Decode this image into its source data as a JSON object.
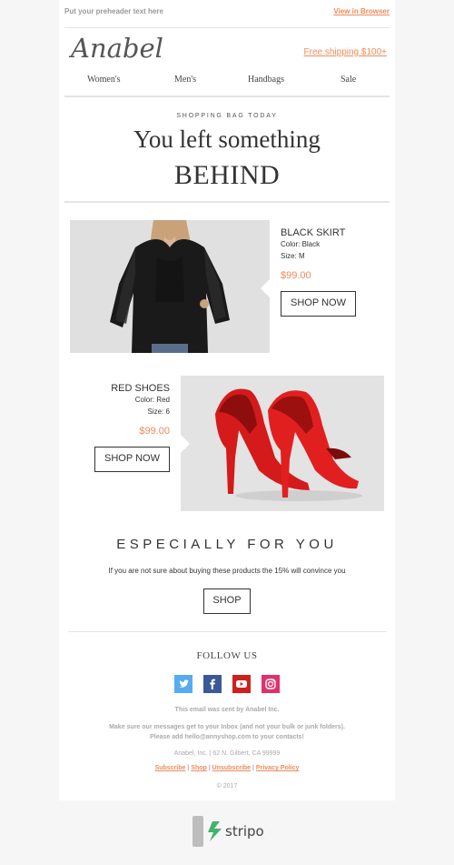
{
  "preheader": {
    "text": "Put your preheader text here",
    "view_link": "View in Browser"
  },
  "header": {
    "logo": "Anabel",
    "shipping": "Free shipping $100+"
  },
  "nav": {
    "items": [
      "Women's",
      "Men's",
      "Handbags",
      "Sale"
    ]
  },
  "hero": {
    "kicker": "SHOPPING BAG TODAY",
    "line1": "You left something",
    "line2": "BEHIND"
  },
  "products": [
    {
      "name": "BLACK SKIRT",
      "color": "Color: Black",
      "size": "Size: M",
      "price": "$99.00",
      "button": "SHOP NOW"
    },
    {
      "name": "RED SHOES",
      "color": "Color: Red",
      "size": "Size: 6",
      "price": "$99.00",
      "button": "SHOP NOW"
    }
  ],
  "promo": {
    "title": "ESPECIALLY FOR YOU",
    "text": "If you are not sure about buying these products the 15% will convince you",
    "button": "SHOP"
  },
  "social": {
    "title": "FOLLOW US",
    "icons": [
      "twitter-icon",
      "facebook-icon",
      "youtube-icon",
      "instagram-icon"
    ]
  },
  "footer": {
    "sent_by": "This email was sent by Anabel Inc.",
    "inbox_line1": "Make sure our messages get to your Inbox (and not your bulk or junk folders).",
    "inbox_line2": "Please add hello@annyshop.com to your contacts!",
    "address": "Anabel, Inc. | 62 N. Gilbert, CA 99999",
    "links": [
      "Subscribe",
      "Shop",
      "Unsubscribe",
      "Privacy Policy"
    ],
    "copyright": "© 2017"
  },
  "badge": {
    "brand": "stripo"
  },
  "colors": {
    "accent": "#ef8a5a",
    "twitter": "#55acee",
    "facebook": "#3b5998",
    "youtube": "#cd201f",
    "instagram": "#e1306c"
  }
}
